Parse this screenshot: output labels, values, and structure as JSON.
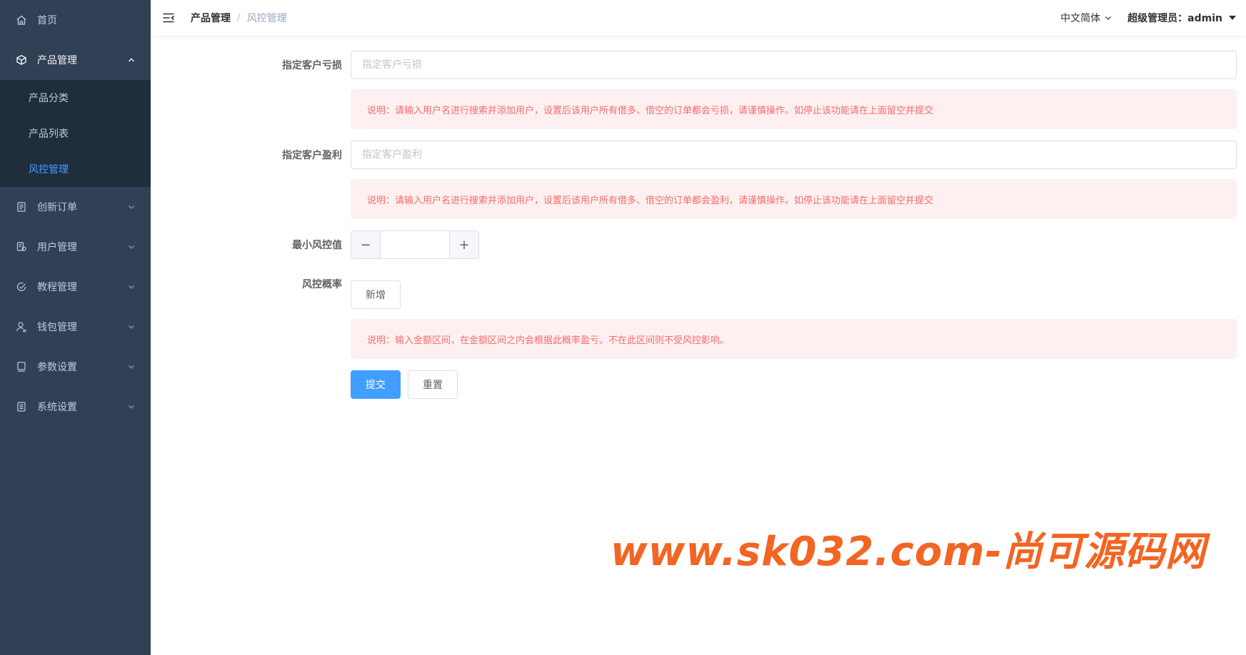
{
  "sidebar": {
    "home": "首页",
    "product_mgmt": "产品管理",
    "product_sub": [
      "产品分类",
      "产品列表",
      "风控管理"
    ],
    "items": [
      "创新订单",
      "用户管理",
      "教程管理",
      "钱包管理",
      "参数设置",
      "系统设置"
    ],
    "active_color": "#409eff",
    "bg_color": "#304156"
  },
  "header": {
    "breadcrumb_first": "产品管理",
    "breadcrumb_sep": "/",
    "breadcrumb_current": "风控管理",
    "language": "中文简体",
    "user": "超级管理员：admin"
  },
  "form": {
    "loss_label": "指定客户亏损",
    "loss_placeholder": "指定客户亏损",
    "loss_note": "说明：请输入用户名进行搜索并添加用户，设置后该用户所有借多、借空的订单都会亏损，请谨慎操作。如停止该功能请在上面留空并提交",
    "profit_label": "指定客户盈利",
    "profit_placeholder": "指定客户盈利",
    "profit_note": "说明：请输入用户名进行搜索并添加用户，设置后该用户所有借多、借空的订单都会盈利，请谨慎操作。如停止该功能请在上面留空并提交",
    "min_label": "最小风控值",
    "minus": "−",
    "plus": "+",
    "rate_label": "风控概率",
    "add_button": "新增",
    "rate_note": "说明：输入金额区间，在金额区间之内会根据此概率盈亏。不在此区间则不受风控影响。",
    "submit": "提交",
    "reset": "重置"
  },
  "watermark": "www.sk032.com-尚可源码网"
}
